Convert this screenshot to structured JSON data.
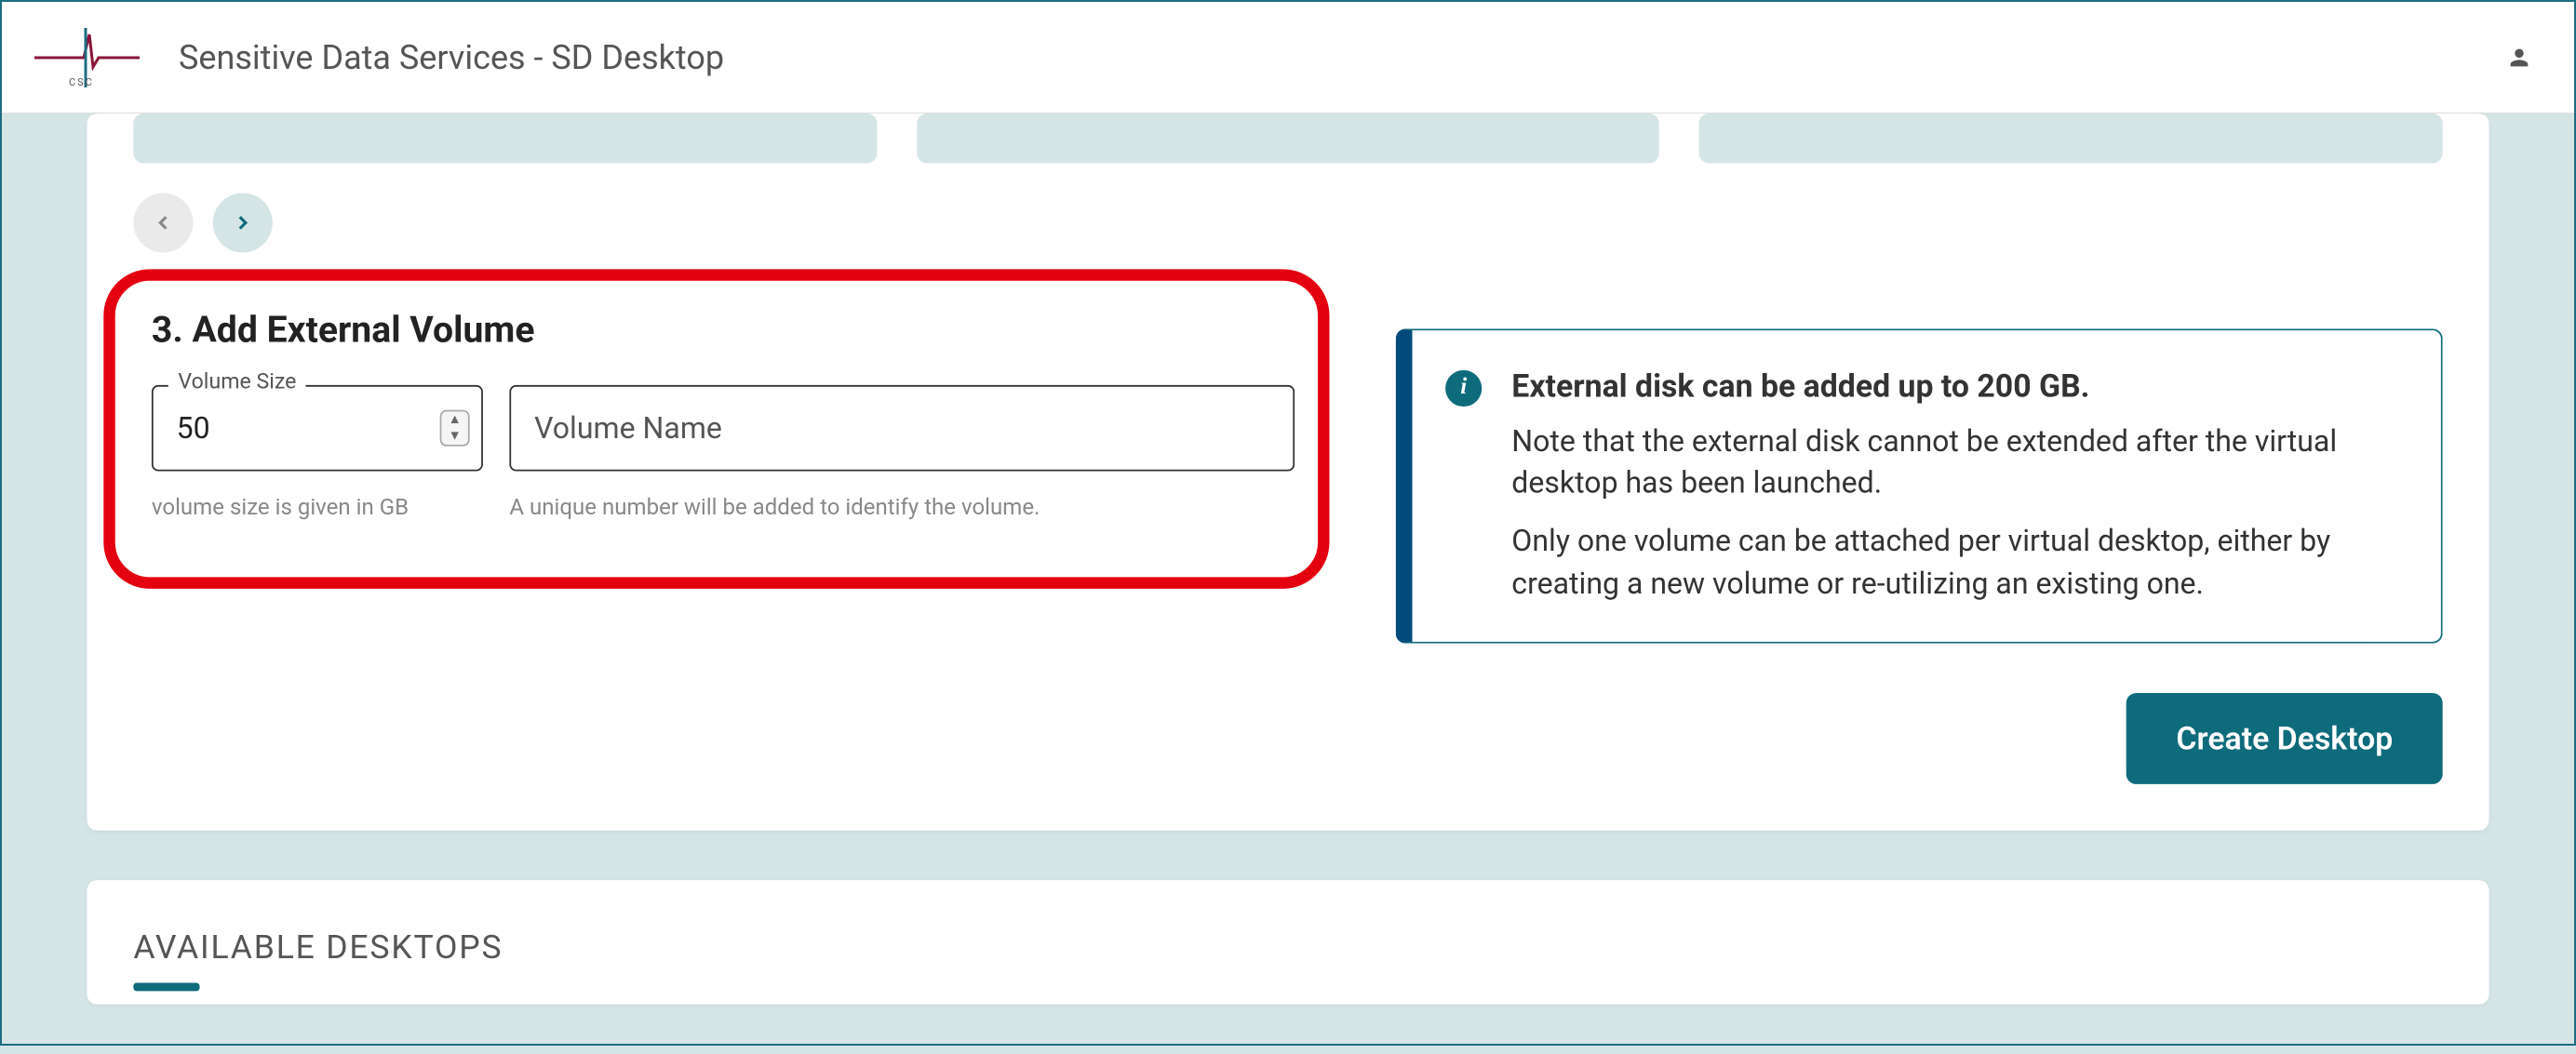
{
  "header": {
    "title": "Sensitive Data Services - SD Desktop"
  },
  "section": {
    "title": "3. Add External Volume",
    "volumeSize": {
      "label": "Volume Size",
      "value": "50",
      "helper": "volume size is given in GB"
    },
    "volumeName": {
      "placeholder": "Volume Name",
      "helper": "A unique number will be added to identify the volume."
    }
  },
  "infoBox": {
    "title": "External disk can be added up to 200 GB.",
    "p1": "Note that the external disk cannot be extended after the virtual desktop has been launched.",
    "p2": "Only one volume can be attached per virtual desktop, either by creating a new volume or re-utilizing an existing one."
  },
  "createButton": "Create Desktop",
  "available": {
    "heading": "AVAILABLE DESKTOPS"
  }
}
